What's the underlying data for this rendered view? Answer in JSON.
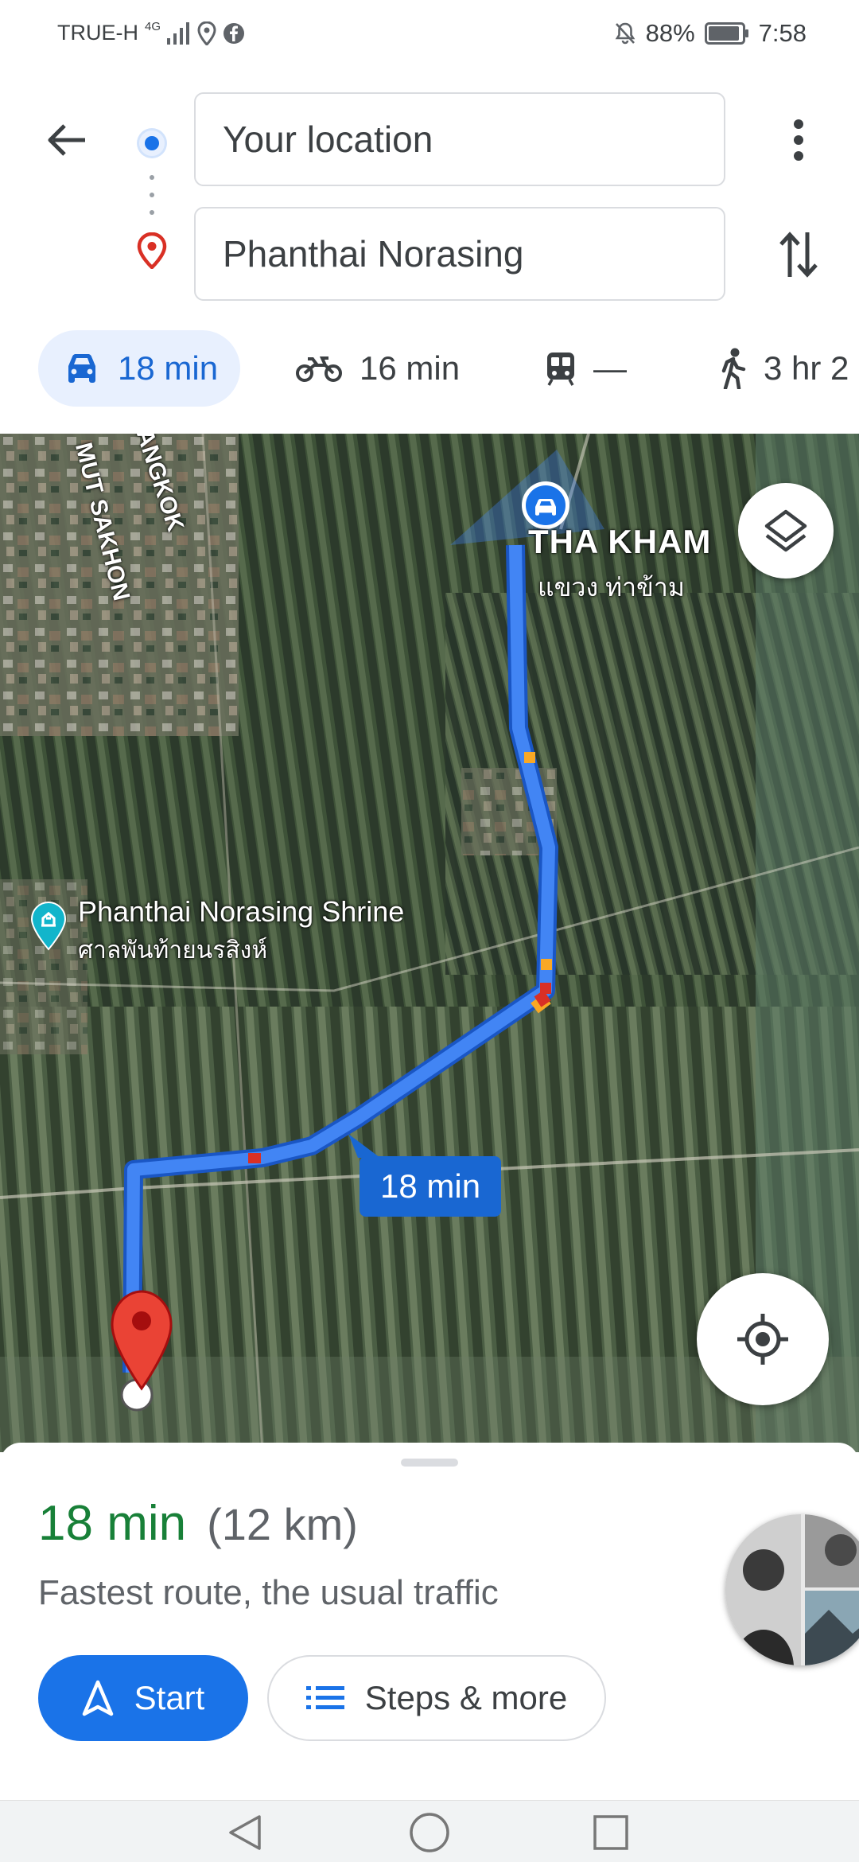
{
  "status_bar": {
    "carrier": "TRUE-H",
    "network": "4G",
    "battery": "88%",
    "time": "7:58"
  },
  "directions": {
    "origin": "Your location",
    "destination": "Phanthai Norasing",
    "icons": {
      "back": "arrow-back-icon",
      "more": "more-vert-icon",
      "swap": "swap-vert-icon",
      "origin": "origin-dot-icon",
      "destination": "destination-pin-icon"
    }
  },
  "modes": [
    {
      "name": "drive",
      "icon": "car-icon",
      "label": "18 min",
      "selected": true
    },
    {
      "name": "motorcycle",
      "icon": "motorcycle-icon",
      "label": "16 min",
      "selected": false
    },
    {
      "name": "transit",
      "icon": "train-icon",
      "label": "—",
      "selected": false
    },
    {
      "name": "walk",
      "icon": "walk-icon",
      "label": "3 hr 2",
      "selected": false
    }
  ],
  "map": {
    "labels": {
      "area_en": "THA KHAM",
      "area_th": "แขวง ท่าข้าม",
      "poi_en": "Phanthai Norasing Shrine",
      "poi_th": "ศาลพันท้ายนรสิงห์",
      "road_1": "MUT SAKHON",
      "road_2": "ANGKOK"
    },
    "route_time": "18 min",
    "route_color": "#4285f4",
    "traffic_slow_color": "#f9a825",
    "traffic_heavy_color": "#d93025"
  },
  "sheet": {
    "duration": "18 min",
    "distance": "(12 km)",
    "note": "Fastest route, the usual traffic",
    "start_label": "Start",
    "steps_label": "Steps & more"
  },
  "colors": {
    "accent": "#1a73e8",
    "duration_green": "#188038"
  }
}
